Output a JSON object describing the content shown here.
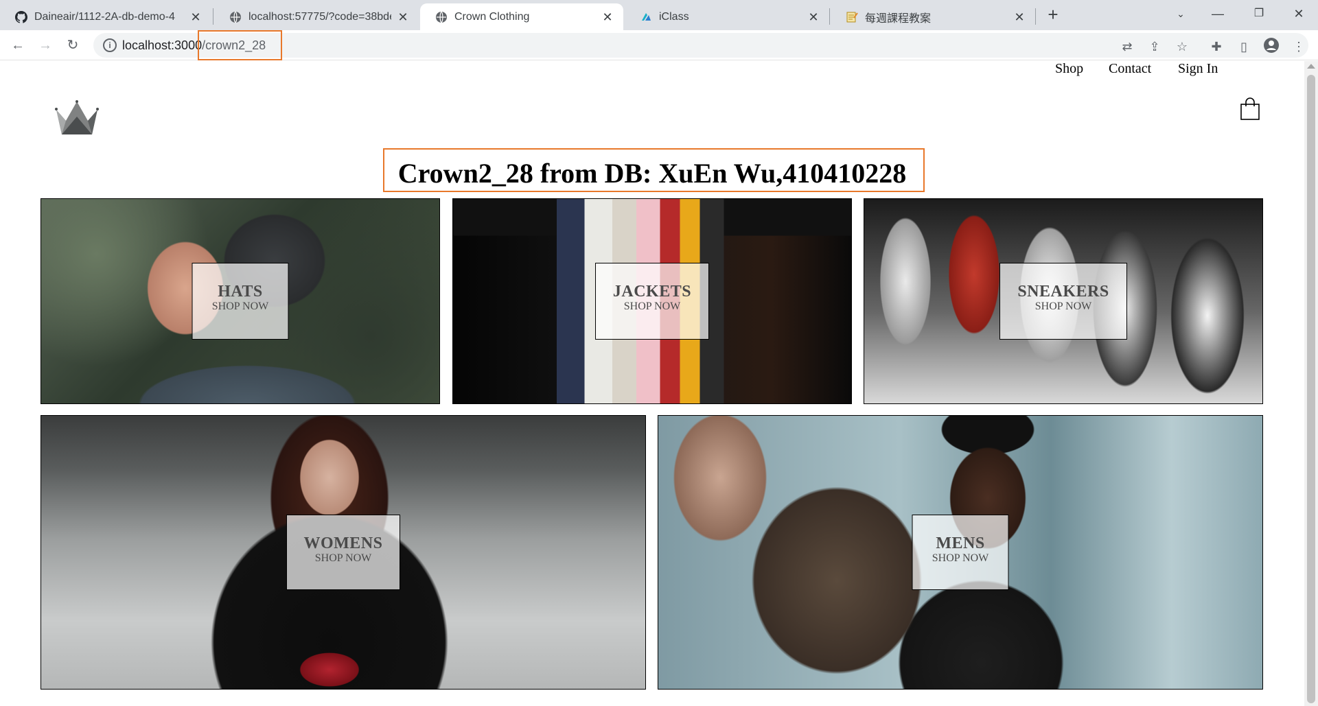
{
  "browser": {
    "tabs": [
      {
        "title": "Daineair/1112-2A-db-demo-4",
        "icon": "github-icon"
      },
      {
        "title": "localhost:57775/?code=38bde",
        "icon": "globe-icon"
      },
      {
        "title": "Crown Clothing",
        "icon": "globe-icon",
        "active": true
      },
      {
        "title": "iClass",
        "icon": "iclass-icon"
      },
      {
        "title": "每週課程教案",
        "icon": "notepad-icon"
      }
    ],
    "url_host": "localhost:3000",
    "url_path": "/crown2_28"
  },
  "nav": {
    "shop": "Shop",
    "contact": "Contact",
    "sign_in": "Sign In"
  },
  "headline": "Crown2_28 from DB: XuEn Wu,410410228",
  "categories": [
    {
      "title": "HATS",
      "subtitle": "SHOP NOW"
    },
    {
      "title": "JACKETS",
      "subtitle": "SHOP NOW"
    },
    {
      "title": "SNEAKERS",
      "subtitle": "SHOP NOW"
    },
    {
      "title": "WOMENS",
      "subtitle": "SHOP NOW"
    },
    {
      "title": "MENS",
      "subtitle": "SHOP NOW"
    }
  ],
  "colors": {
    "highlight": "#e8782a"
  }
}
